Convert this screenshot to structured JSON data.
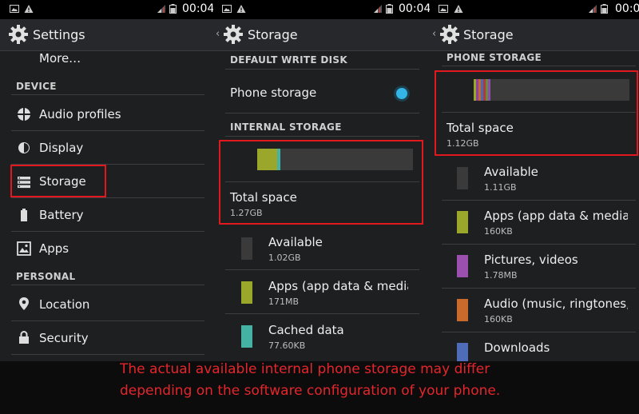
{
  "status": {
    "time": "00:04"
  },
  "settings": {
    "title": "Settings",
    "more": "More…",
    "device_header": "DEVICE",
    "items": [
      {
        "label": "Audio profiles",
        "icon": "audio-profiles-icon"
      },
      {
        "label": "Display",
        "icon": "display-brightness-icon"
      },
      {
        "label": "Storage",
        "icon": "storage-icon"
      },
      {
        "label": "Battery",
        "icon": "battery-icon"
      },
      {
        "label": "Apps",
        "icon": "apps-icon"
      }
    ],
    "personal_header": "PERSONAL",
    "personal_items": [
      {
        "label": "Location",
        "icon": "location-pin-icon"
      },
      {
        "label": "Security",
        "icon": "lock-icon"
      }
    ]
  },
  "storage_internal": {
    "title": "Storage",
    "write_disk_header": "DEFAULT WRITE DISK",
    "phone_storage": "Phone storage",
    "phone_storage_selected": true,
    "internal_header": "INTERNAL STORAGE",
    "total_label": "Total space",
    "total_value": "1.27GB",
    "usage_fractions": {
      "apps": 0.13,
      "cached": 0.02
    },
    "items": [
      {
        "label": "Available",
        "value": "1.02GB",
        "color": "#3a3a3a"
      },
      {
        "label": "Apps (app data & media c",
        "value": "171MB",
        "color": "#9aa72a"
      },
      {
        "label": "Cached data",
        "value": "77.60KB",
        "color": "#45b3a3"
      }
    ]
  },
  "storage_phone": {
    "title": "Storage",
    "header": "PHONE STORAGE",
    "total_label": "Total space",
    "total_value": "1.12GB",
    "usage_colors": [
      "#9aa72a",
      "#8e3fa8",
      "#c36a2a",
      "#4c68b5",
      "#b03a3a",
      "#6d8a3a",
      "#8a4fb0"
    ],
    "items": [
      {
        "label": "Available",
        "value": "1.11GB",
        "color": "#3a3a3a"
      },
      {
        "label": "Apps (app data & media c",
        "value": "160KB",
        "color": "#9aa72a"
      },
      {
        "label": "Pictures, videos",
        "value": "1.78MB",
        "color": "#9b4fae"
      },
      {
        "label": "Audio (music, ringtones, p",
        "value": "160KB",
        "color": "#c86a2c"
      },
      {
        "label": "Downloads",
        "value": "",
        "color": "#4e6cb8"
      }
    ]
  },
  "caption": {
    "line1": "The actual available internal phone storage may differ",
    "line2": "depending on the software configuration of your phone."
  },
  "colors": {
    "highlight": "#e1191f",
    "accent": "#33b5e5"
  }
}
